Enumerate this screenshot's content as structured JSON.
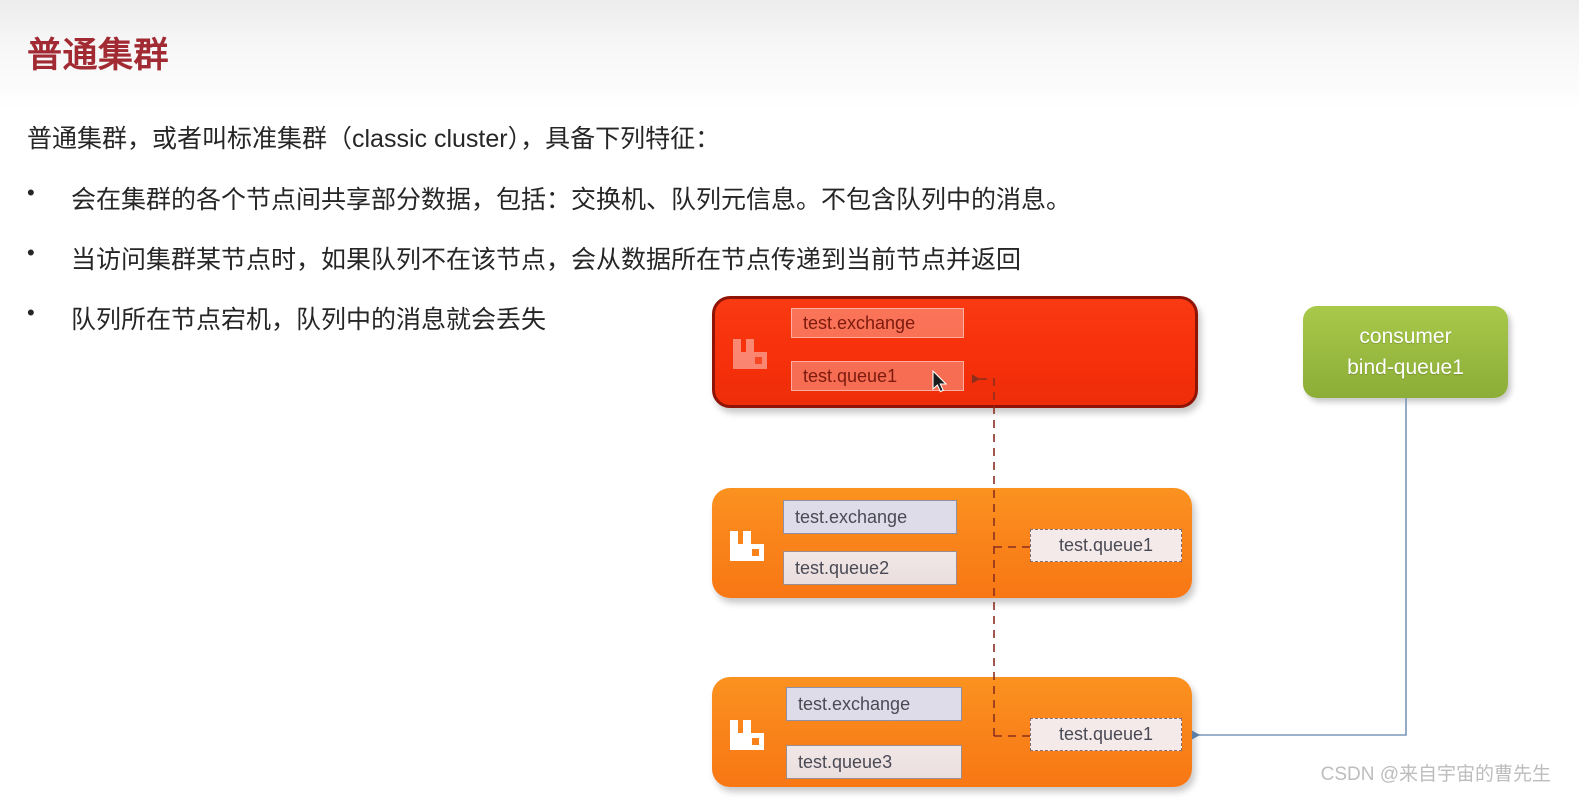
{
  "slide": {
    "title": "普通集群",
    "intro": "普通集群，或者叫标准集群（classic cluster），具备下列特征：",
    "bullet_marker": "•",
    "bullets": [
      "会在集群的各个节点间共享部分数据，包括：交换机、队列元信息。不包含队列中的消息。",
      "当访问集群某节点时，如果队列不在该节点，会从数据所在节点传递到当前节点并返回",
      "队列所在节点宕机，队列中的消息就会丢失"
    ],
    "watermark": "CSDN @来自宇宙的曹先生"
  },
  "diagram": {
    "nodes": [
      {
        "id": "node-red",
        "state": "down",
        "logo_icon": "rabbitmq-logo-icon",
        "exchange_label": "test.exchange",
        "queue_label": "test.queue1",
        "remote_queue_label": null
      },
      {
        "id": "node-orange-1",
        "state": "up",
        "logo_icon": "rabbitmq-logo-icon",
        "exchange_label": "test.exchange",
        "queue_label": "test.queue2",
        "remote_queue_label": "test.queue1"
      },
      {
        "id": "node-orange-2",
        "state": "up",
        "logo_icon": "rabbitmq-logo-icon",
        "exchange_label": "test.exchange",
        "queue_label": "test.queue3",
        "remote_queue_label": "test.queue1"
      }
    ],
    "consumer": {
      "line1": "consumer",
      "line2": "bind-queue1"
    },
    "cursor_icon": "mouse-pointer-icon",
    "colors": {
      "title": "#a12a33",
      "node_down": "#f6300b",
      "node_up": "#f9821a",
      "consumer": "#8cad37",
      "dashed_link": "#8b2f1f",
      "consumer_link": "#7a95b8"
    }
  }
}
